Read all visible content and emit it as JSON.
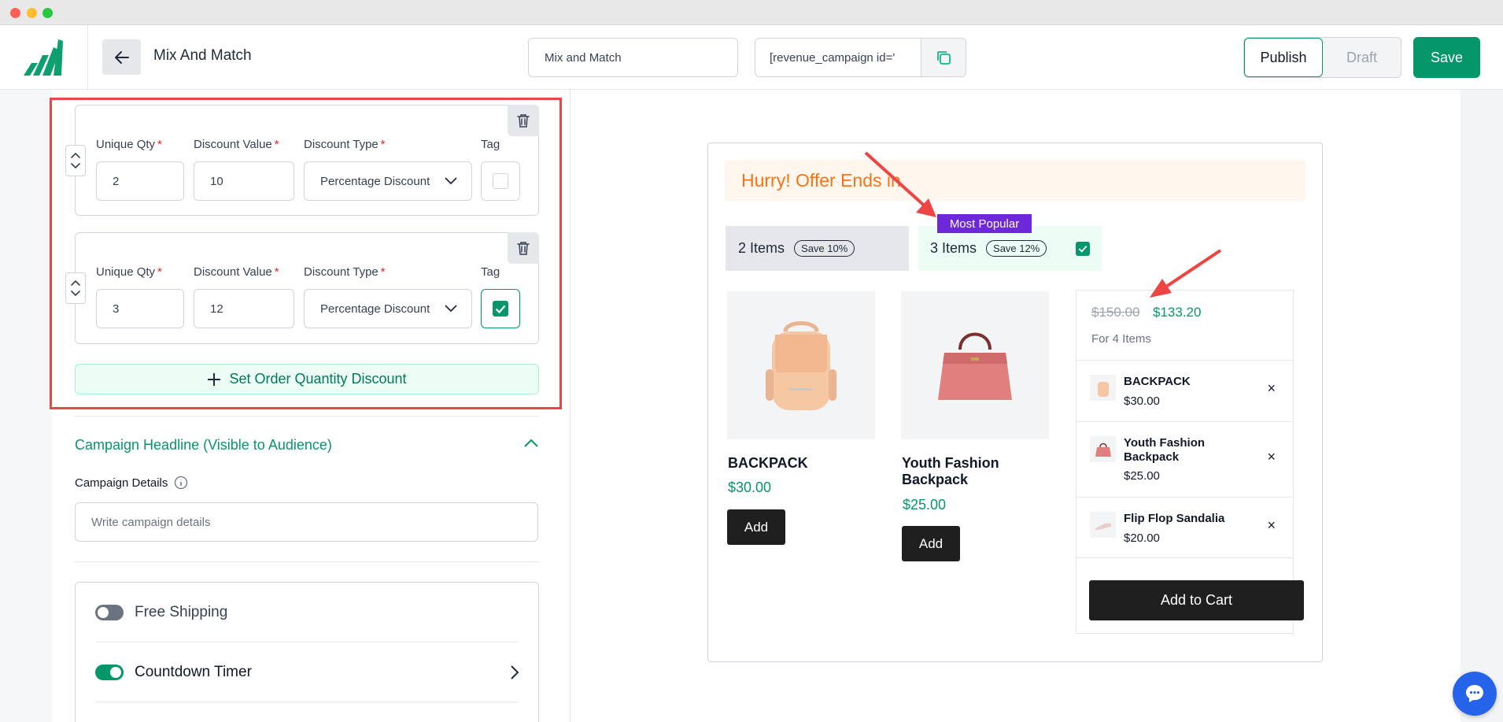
{
  "header": {
    "title": "Mix And Match",
    "campaign_name": "Mix and Match",
    "shortcode": "[revenue_campaign id='",
    "publish_label": "Publish",
    "draft_label": "Draft",
    "save_label": "Save"
  },
  "tiers": [
    {
      "qty_label": "Unique Qty",
      "value_label": "Discount Value",
      "type_label": "Discount Type",
      "tag_label": "Tag",
      "qty": "2",
      "discount_value": "10",
      "discount_type": "Percentage Discount",
      "tag_checked": false
    },
    {
      "qty_label": "Unique Qty",
      "value_label": "Discount Value",
      "type_label": "Discount Type",
      "tag_label": "Tag",
      "qty": "3",
      "discount_value": "12",
      "discount_type": "Percentage Discount",
      "tag_checked": true
    }
  ],
  "required_mark": "*",
  "add_tier_label": "Set Order Quantity Discount",
  "headline_section": {
    "title": "Campaign Headline (Visible to Audience)",
    "details_label": "Campaign Details",
    "details_placeholder": "Write campaign details"
  },
  "settings": {
    "free_shipping": "Free Shipping",
    "countdown_timer": "Countdown Timer"
  },
  "preview": {
    "banner": "Hurry! Offer Ends in",
    "badge": "Most Popular",
    "options": [
      {
        "label": "2 Items",
        "save": "Save 10%"
      },
      {
        "label": "3 Items",
        "save": "Save 12%"
      }
    ],
    "products": [
      {
        "name": "BACKPACK",
        "price": "$30.00",
        "button": "Add"
      },
      {
        "name": "Youth Fashion Backpack",
        "price": "$25.00",
        "button": "Add"
      }
    ],
    "summary": {
      "old_price": "$150.00",
      "new_price": "$133.20",
      "count": "For 4 Items",
      "items": [
        {
          "name": "BACKPACK",
          "price": "$30.00"
        },
        {
          "name": "Youth Fashion Backpack",
          "price": "$25.00"
        },
        {
          "name": "Flip Flop Sandalia",
          "price": "$20.00"
        }
      ],
      "cart_button": "Add to Cart",
      "remove_glyph": "×"
    }
  },
  "colors": {
    "brand": "#059669",
    "badge": "#6d28d9",
    "banner_text": "#f97316",
    "annotation": "#ef4444"
  }
}
